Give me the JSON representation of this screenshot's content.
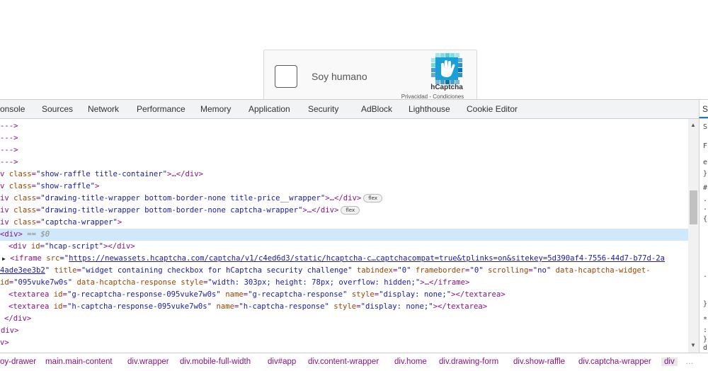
{
  "captcha": {
    "label": "Soy humano",
    "brand": "hCaptcha",
    "link_privacy": "Privacidad",
    "link_separator": " - ",
    "link_terms": "Condiciones",
    "logo_icon": "hcaptcha-hand-icon",
    "colors": {
      "logo_light": "#4fd1db",
      "logo_dark": "#0074bf"
    }
  },
  "devtools": {
    "tabs": [
      "onsole",
      "Sources",
      "Network",
      "Performance",
      "Memory",
      "Application",
      "Security",
      "AdBlock",
      "Lighthouse",
      "Cookie Editor"
    ],
    "side_tab": "S",
    "elements": {
      "l1": "--->",
      "l2": "--->",
      "l3": "--->",
      "l4": "--->",
      "l5_tag_open": "v ",
      "l5_attr": "class",
      "l5_val": "\"show-raffle title-container\"",
      "l5_rest": ">…</div>",
      "l6_tag_open": "v ",
      "l6_attr": "class",
      "l6_val": "\"show-raffle\"",
      "l6_rest": ">",
      "l7_tag_open": "iv ",
      "l7_attr": "class",
      "l7_val": "\"drawing-title-wrapper bottom-border-none title-price__wrapper\"",
      "l7_rest": ">…</div>",
      "l7_badge": "flex",
      "l8_tag_open": "iv ",
      "l8_attr": "class",
      "l8_val": "\"drawing-title-wrapper bottom-border-none captcha-wrapper\"",
      "l8_rest": ">…</div>",
      "l8_badge": "flex",
      "l9_tag_open": "iv ",
      "l9_attr": "class",
      "l9_val": "\"captcha-wrapper\"",
      "l9_rest": ">",
      "l10_tag": "<div>",
      "l10_marker": " == $0",
      "l11_tag_open": "<div ",
      "l11_attr": "id",
      "l11_val": "\"hcap-script\"",
      "l11_rest": "></div>",
      "l12_tag_open": "<iframe ",
      "l12_attr": "src",
      "l12_eq": "=\"",
      "l12_link": "https://newassets.hcaptcha.com/captcha/v1/c4ed6d3/static/hcaptcha-c…captchacompat=true&tplinks=on&sitekey=5d390af4-7556-44d7-b77d-2a",
      "l13_link": "4ade3ee3b2",
      "l13_q": "\"",
      "l13_attr1": "title",
      "l13_val1": "\"widget containing checkbox for hCaptcha security challenge\"",
      "l13_attr2": "tabindex",
      "l13_val2": "\"0\"",
      "l13_attr3": "frameborder",
      "l13_val3": "\"0\"",
      "l13_attr4": "scrolling",
      "l13_val4": "\"no\"",
      "l13_attr5": "data-hcaptcha-widget-",
      "l14_attr0": "id",
      "l14_val0": "\"095vuke7w0s\"",
      "l14_attr1": "data-hcaptcha-response",
      "l14_attr2": "style",
      "l14_val2": "\"width: 303px; height: 78px; overflow: hidden;\"",
      "l14_rest": ">…</iframe>",
      "l15_tag_open": "<textarea ",
      "l15_attr1": "id",
      "l15_val1": "\"g-recaptcha-response-095vuke7w0s\"",
      "l15_attr2": "name",
      "l15_val2": "\"g-recaptcha-response\"",
      "l15_attr3": "style",
      "l15_val3": "\"display: none;\"",
      "l15_rest": "></textarea>",
      "l16_tag_open": "<textarea ",
      "l16_attr1": "id",
      "l16_val1": "\"h-captcha-response-095vuke7w0s\"",
      "l16_attr2": "name",
      "l16_val2": "\"h-captcha-response\"",
      "l16_attr3": "style",
      "l16_val3": "\"display: none;\"",
      "l16_rest": "></textarea>",
      "l17": "</div>",
      "l18": "div>",
      "l19": "v>"
    },
    "styles_chars": [
      "S",
      "F",
      "e",
      "}",
      "#",
      ".",
      ".",
      "{",
      ".",
      "}",
      "*",
      ":",
      "}",
      "d"
    ],
    "breadcrumb": [
      "oy-drawer",
      "main.main-content",
      "div.wrapper",
      "div.mobile-full-width",
      "div#app",
      "div.content-wrapper",
      "div.home",
      "div.drawing-form",
      "div.show-raffle",
      "div.captcha-wrapper",
      "div"
    ],
    "breadcrumb_more": "…"
  }
}
